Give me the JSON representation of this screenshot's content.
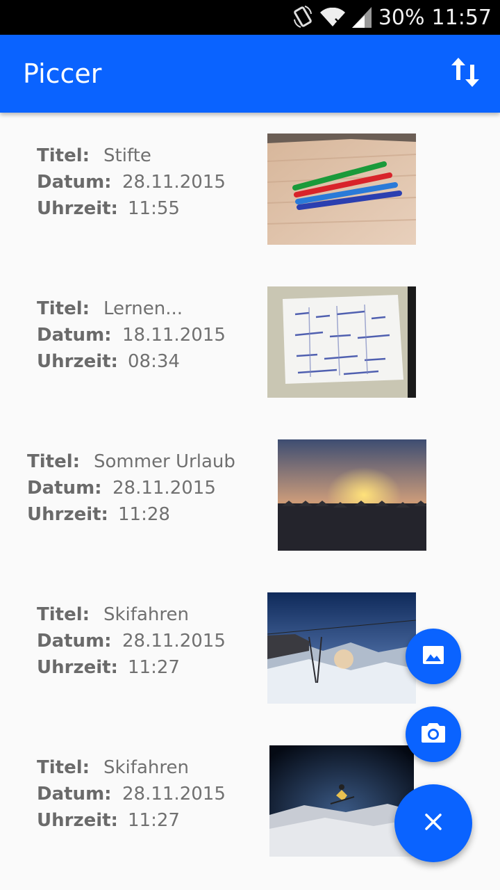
{
  "status_bar": {
    "battery": "30%",
    "time": "11:57",
    "icons": [
      "rotation-icon",
      "wifi-icon",
      "signal-icon"
    ]
  },
  "app_bar": {
    "title": "Piccer",
    "sort_icon": "sort-arrows-icon"
  },
  "labels": {
    "title": "Titel:",
    "date": "Datum:",
    "time": "Uhrzeit:"
  },
  "items": [
    {
      "title": "Stifte",
      "date": "28.11.2015",
      "time": "11:55",
      "image": "pens on wooden desk"
    },
    {
      "title": "Lernen...",
      "date": "18.11.2015",
      "time": "08:34",
      "image": "handwritten notes on paper"
    },
    {
      "title": "Sommer Urlaub",
      "date": "28.11.2015",
      "time": "11:28",
      "image": "sunset at beach with parasols"
    },
    {
      "title": "Skifahren",
      "date": "28.11.2015",
      "time": "11:27",
      "image": "snowy mountain with ski lift"
    },
    {
      "title": "Skifahren",
      "date": "28.11.2015",
      "time": "11:27",
      "image": "skier jumping at night"
    }
  ],
  "fab": {
    "gallery_icon": "image-icon",
    "camera_icon": "camera-icon",
    "close_icon": "close-icon"
  },
  "colors": {
    "primary": "#0a63ff",
    "background": "#fafafa",
    "text": "#6f6f6f"
  }
}
